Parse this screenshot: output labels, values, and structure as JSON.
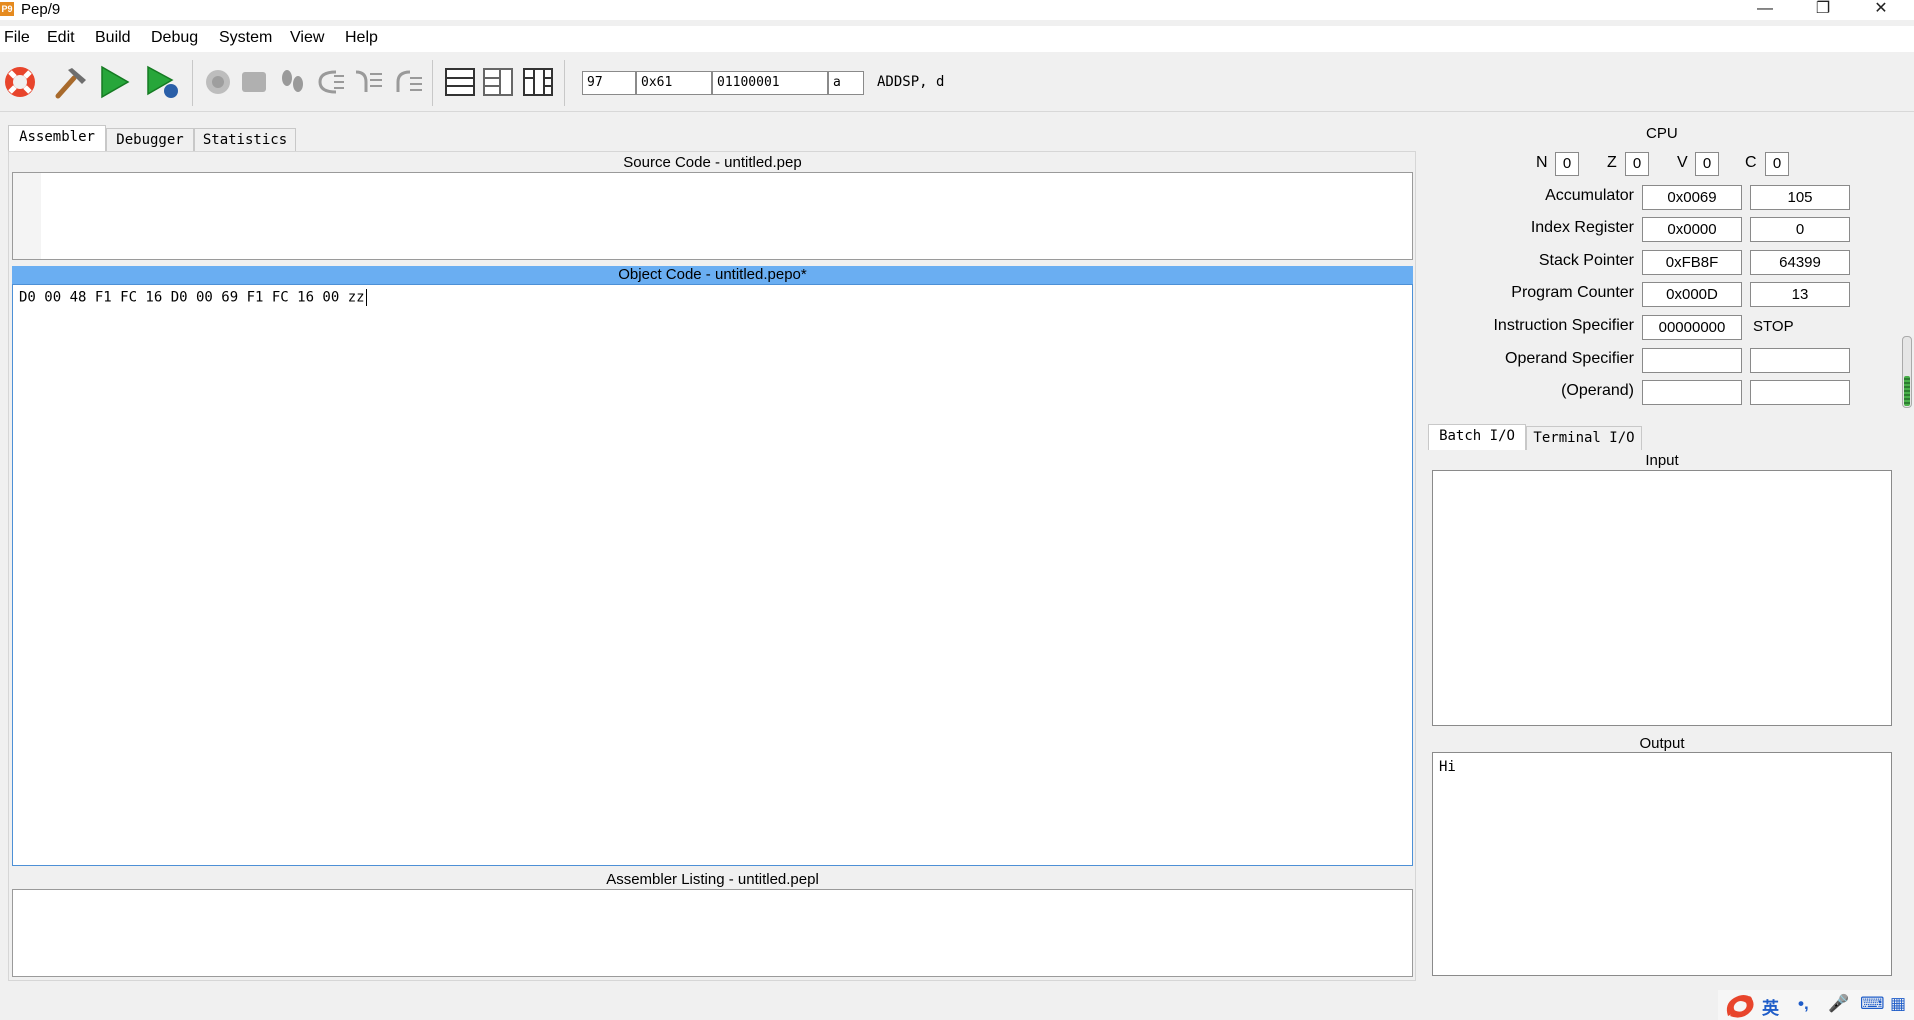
{
  "app": {
    "logo_text": "P9",
    "title": "Pep/9"
  },
  "window_controls": {
    "minimize": "—",
    "maximize": "❐",
    "close": "✕"
  },
  "menu": [
    "File",
    "Edit",
    "Build",
    "Debug",
    "System",
    "View",
    "Help"
  ],
  "converter": {
    "decimal": "97",
    "hex": "0x61",
    "binary": "01100001",
    "char": "a",
    "mnemonic": "ADDSP, d"
  },
  "main_tabs": [
    {
      "label": "Assembler",
      "active": true
    },
    {
      "label": "Debugger",
      "active": false
    },
    {
      "label": "Statistics",
      "active": false
    }
  ],
  "panes": {
    "source_title": "Source Code - untitled.pep",
    "object_title": "Object Code - untitled.pepo*",
    "object_code": "D0 00 48 F1 FC 16 D0 00 69 F1 FC 16 00 zz",
    "listing_title": "Assembler Listing - untitled.pepl"
  },
  "cpu": {
    "title": "CPU",
    "flags": [
      {
        "name": "N",
        "value": "0"
      },
      {
        "name": "Z",
        "value": "0"
      },
      {
        "name": "V",
        "value": "0"
      },
      {
        "name": "C",
        "value": "0"
      }
    ],
    "registers": [
      {
        "label": "Accumulator",
        "hex": "0x0069",
        "dec": "105"
      },
      {
        "label": "Index Register",
        "hex": "0x0000",
        "dec": "0"
      },
      {
        "label": "Stack Pointer",
        "hex": "0xFB8F",
        "dec": "64399"
      },
      {
        "label": "Program Counter",
        "hex": "0x000D",
        "dec": "13"
      },
      {
        "label": "Instruction Specifier",
        "hex": "00000000",
        "dec": "STOP"
      },
      {
        "label": "Operand Specifier",
        "hex": "",
        "dec": ""
      },
      {
        "label": "(Operand)",
        "hex": "",
        "dec": ""
      }
    ]
  },
  "io_tabs": [
    {
      "label": "Batch I/O",
      "active": true
    },
    {
      "label": "Terminal I/O",
      "active": false
    }
  ],
  "io": {
    "input_title": "Input",
    "output_title": "Output",
    "output_text": "Hi"
  },
  "ime": {
    "lang": "英",
    "punct": "•,",
    "mic": "🎤",
    "keyboard": "⌨",
    "grid": "▦"
  }
}
